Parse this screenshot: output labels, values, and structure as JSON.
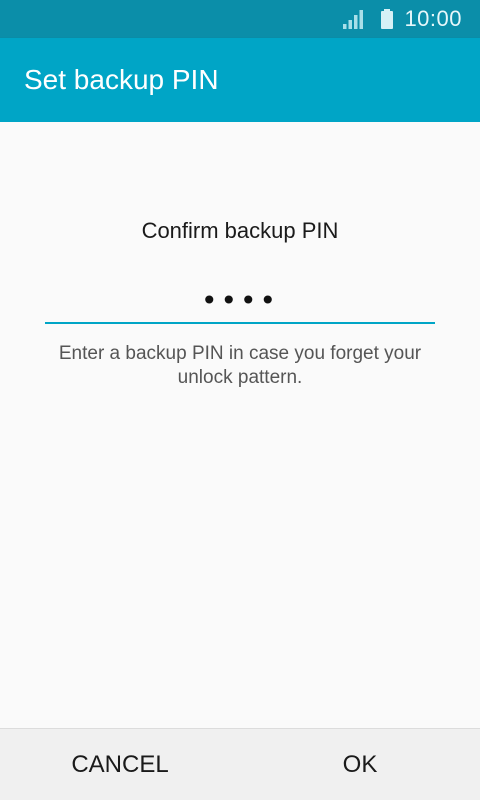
{
  "status_bar": {
    "time": "10:00",
    "signal_icon": "signal-icon",
    "battery_icon": "battery-icon"
  },
  "app_bar": {
    "title": "Set backup PIN"
  },
  "main": {
    "prompt": "Confirm backup PIN",
    "pin_value": "••••",
    "hint": "Enter a backup PIN in case you forget your unlock pattern."
  },
  "buttons": {
    "cancel_label": "CANCEL",
    "ok_label": "OK"
  },
  "colors": {
    "status_bar": "#0b8ea9",
    "app_bar": "#00a5c6",
    "accent": "#00a5c6"
  }
}
